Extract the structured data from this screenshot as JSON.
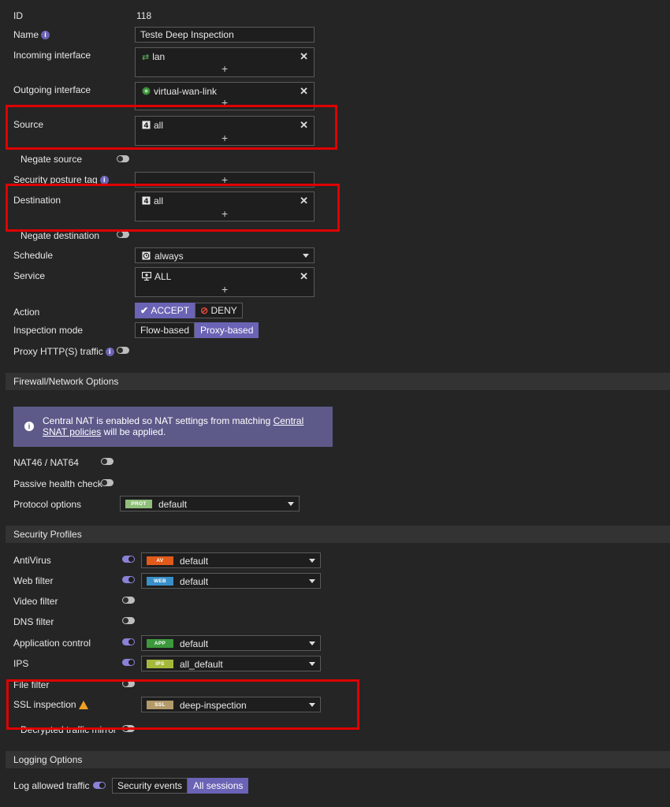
{
  "policy": {
    "id_label": "ID",
    "id_value": "118",
    "name_label": "Name",
    "name_value": "Teste Deep Inspection",
    "incoming_label": "Incoming interface",
    "incoming_value": "lan",
    "outgoing_label": "Outgoing interface",
    "outgoing_value": "virtual-wan-link",
    "source_label": "Source",
    "source_value": "all",
    "negate_source_label": "Negate source",
    "posture_label": "Security posture tag",
    "destination_label": "Destination",
    "destination_value": "all",
    "negate_destination_label": "Negate destination",
    "schedule_label": "Schedule",
    "schedule_value": "always",
    "service_label": "Service",
    "service_value": "ALL",
    "action_label": "Action",
    "action_accept": "ACCEPT",
    "action_deny": "DENY",
    "inspection_label": "Inspection mode",
    "inspection_flow": "Flow-based",
    "inspection_proxy": "Proxy-based",
    "proxy_label": "Proxy HTTP(S) traffic",
    "plus": "+",
    "remove": "✕"
  },
  "firewall": {
    "section_title": "Firewall/Network Options",
    "notice_text": "Central NAT is enabled so NAT settings from matching ",
    "notice_link": "Central SNAT policies",
    "notice_tail": " will be applied.",
    "nat46_label": "NAT46 / NAT64",
    "passive_label": "Passive health check",
    "protocol_label": "Protocol options",
    "protocol_badge": "PROT",
    "protocol_value": "default"
  },
  "security": {
    "section_title": "Security Profiles",
    "antivirus_label": "AntiVirus",
    "antivirus_badge": "AV",
    "antivirus_value": "default",
    "webfilter_label": "Web filter",
    "webfilter_badge": "WEB",
    "webfilter_value": "default",
    "video_label": "Video filter",
    "dns_label": "DNS filter",
    "appcontrol_label": "Application control",
    "appcontrol_badge": "APP",
    "appcontrol_value": "default",
    "ips_label": "IPS",
    "ips_badge": "IPS",
    "ips_value": "all_default",
    "filefilter_label": "File filter",
    "ssl_label": "SSL inspection",
    "ssl_badge": "SSL",
    "ssl_value": "deep-inspection",
    "decrypted_label": "Decrypted traffic mirror"
  },
  "logging": {
    "section_title": "Logging Options",
    "log_label": "Log allowed traffic",
    "security_events": "Security events",
    "all_sessions": "All sessions"
  },
  "colors": {
    "accent": "#6b63b5",
    "highlight_box": "#e00000",
    "av_badge": "#e05a1a",
    "web_badge": "#3a8fc8",
    "app_badge": "#3c9a3c",
    "ips_badge": "#a5b83a",
    "ssl_badge": "#b39a6a",
    "prot_badge": "#8fbf7a"
  }
}
